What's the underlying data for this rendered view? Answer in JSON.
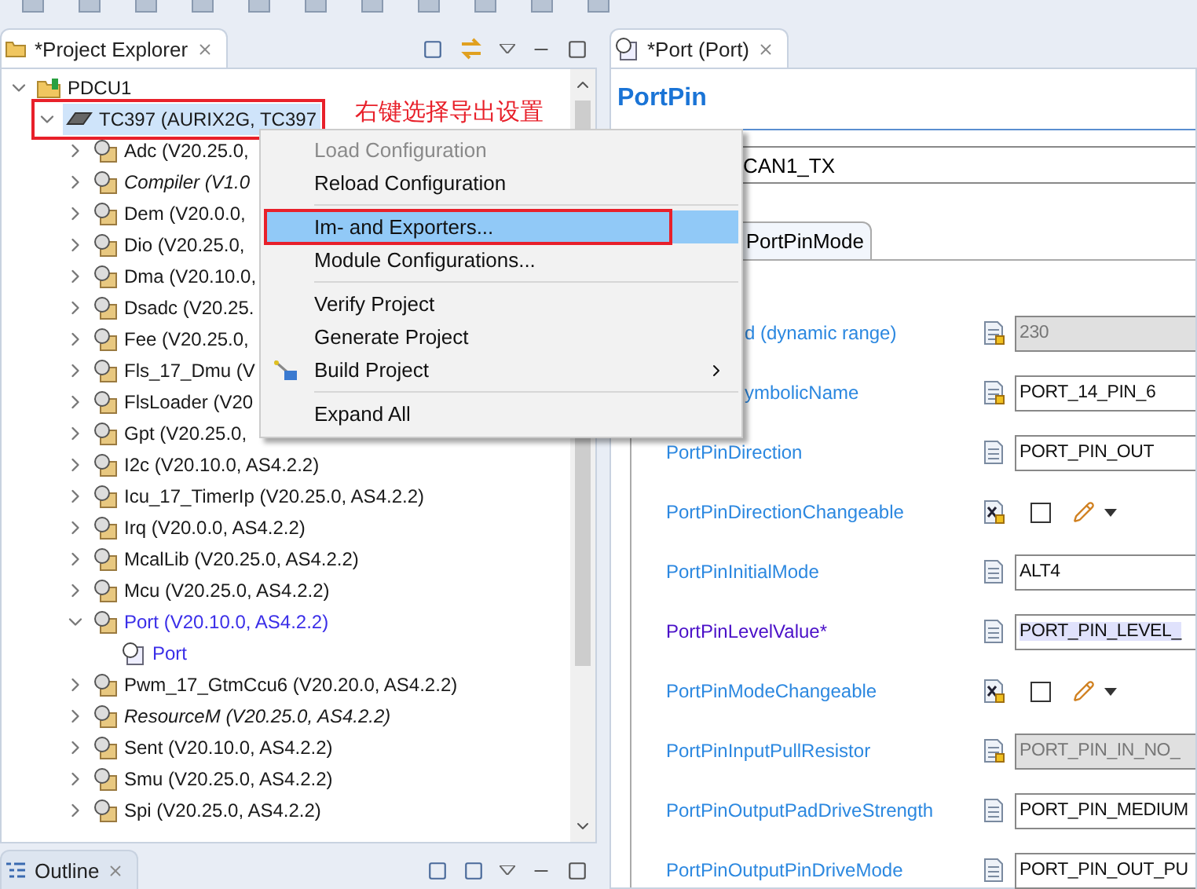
{
  "explorer": {
    "tab": {
      "title": "*Project Explorer"
    },
    "tree": [
      {
        "kind": "project",
        "label": "PDCU1",
        "expanded": true,
        "selected": false,
        "marked": false,
        "italic": false,
        "active": false,
        "children": [
          {
            "kind": "chip",
            "label": "TC397 (AURIX2G, TC397",
            "expanded": true,
            "selected": true,
            "marked": true,
            "italic": false,
            "active": false,
            "children": [
              {
                "kind": "module",
                "label": "Adc (V20.25.0,",
                "expanded": false,
                "selected": false,
                "marked": false,
                "italic": false,
                "active": false
              },
              {
                "kind": "module",
                "label": "Compiler (V1.0",
                "expanded": false,
                "selected": false,
                "marked": false,
                "italic": true,
                "active": false
              },
              {
                "kind": "module",
                "label": "Dem (V20.0.0,",
                "expanded": false,
                "selected": false,
                "marked": false,
                "italic": false,
                "active": false
              },
              {
                "kind": "module",
                "label": "Dio (V20.25.0,",
                "expanded": false,
                "selected": false,
                "marked": false,
                "italic": false,
                "active": false
              },
              {
                "kind": "module",
                "label": "Dma (V20.10.0,",
                "expanded": false,
                "selected": false,
                "marked": false,
                "italic": false,
                "active": false
              },
              {
                "kind": "module",
                "label": "Dsadc (V20.25.",
                "expanded": false,
                "selected": false,
                "marked": false,
                "italic": false,
                "active": false
              },
              {
                "kind": "module",
                "label": "Fee (V20.25.0,",
                "expanded": false,
                "selected": false,
                "marked": false,
                "italic": false,
                "active": false
              },
              {
                "kind": "module",
                "label": "Fls_17_Dmu (V",
                "expanded": false,
                "selected": false,
                "marked": false,
                "italic": false,
                "active": false
              },
              {
                "kind": "module",
                "label": "FlsLoader (V20",
                "expanded": false,
                "selected": false,
                "marked": false,
                "italic": false,
                "active": false
              },
              {
                "kind": "module",
                "label": "Gpt (V20.25.0,",
                "expanded": false,
                "selected": false,
                "marked": false,
                "italic": false,
                "active": false
              },
              {
                "kind": "module",
                "label": "I2c (V20.10.0, AS4.2.2)",
                "expanded": false,
                "selected": false,
                "marked": false,
                "italic": false,
                "active": false
              },
              {
                "kind": "module",
                "label": "Icu_17_TimerIp (V20.25.0, AS4.2.2)",
                "expanded": false,
                "selected": false,
                "marked": false,
                "italic": false,
                "active": false
              },
              {
                "kind": "module",
                "label": "Irq (V20.0.0, AS4.2.2)",
                "expanded": false,
                "selected": false,
                "marked": false,
                "italic": false,
                "active": false
              },
              {
                "kind": "module",
                "label": "McalLib (V20.25.0, AS4.2.2)",
                "expanded": false,
                "selected": false,
                "marked": false,
                "italic": false,
                "active": false
              },
              {
                "kind": "module",
                "label": "Mcu (V20.25.0, AS4.2.2)",
                "expanded": false,
                "selected": false,
                "marked": false,
                "italic": false,
                "active": false
              },
              {
                "kind": "module",
                "label": "Port (V20.10.0, AS4.2.2)",
                "expanded": true,
                "selected": false,
                "marked": false,
                "italic": false,
                "active": true,
                "children": [
                  {
                    "kind": "config",
                    "label": "Port",
                    "selected": false,
                    "marked": false,
                    "italic": false,
                    "active": true
                  }
                ]
              },
              {
                "kind": "module",
                "label": "Pwm_17_GtmCcu6 (V20.20.0, AS4.2.2)",
                "expanded": false,
                "selected": false,
                "marked": false,
                "italic": false,
                "active": false
              },
              {
                "kind": "module",
                "label": "ResourceM (V20.25.0, AS4.2.2)",
                "expanded": false,
                "selected": false,
                "marked": false,
                "italic": true,
                "active": false
              },
              {
                "kind": "module",
                "label": "Sent (V20.10.0, AS4.2.2)",
                "expanded": false,
                "selected": false,
                "marked": false,
                "italic": false,
                "active": false
              },
              {
                "kind": "module",
                "label": "Smu (V20.25.0, AS4.2.2)",
                "expanded": false,
                "selected": false,
                "marked": false,
                "italic": false,
                "active": false
              },
              {
                "kind": "module",
                "label": "Spi (V20.25.0, AS4.2.2)",
                "expanded": false,
                "selected": false,
                "marked": false,
                "italic": false,
                "active": false
              }
            ]
          }
        ]
      }
    ]
  },
  "annotation": {
    "text": "右键选择导出设置"
  },
  "context_menu": [
    {
      "kind": "item",
      "label": "Load Configuration",
      "disabled": true,
      "selected": false,
      "marked": false,
      "submenu": false,
      "icon": false
    },
    {
      "kind": "item",
      "label": "Reload Configuration",
      "disabled": false,
      "selected": false,
      "marked": false,
      "submenu": false,
      "icon": false
    },
    {
      "kind": "separator"
    },
    {
      "kind": "item",
      "label": "Im- and Exporters...",
      "disabled": false,
      "selected": true,
      "marked": true,
      "submenu": false,
      "icon": false
    },
    {
      "kind": "item",
      "label": "Module Configurations...",
      "disabled": false,
      "selected": false,
      "marked": false,
      "submenu": false,
      "icon": false
    },
    {
      "kind": "separator"
    },
    {
      "kind": "item",
      "label": "Verify Project",
      "disabled": false,
      "selected": false,
      "marked": false,
      "submenu": false,
      "icon": false
    },
    {
      "kind": "item",
      "label": "Generate Project",
      "disabled": false,
      "selected": false,
      "marked": false,
      "submenu": false,
      "icon": false
    },
    {
      "kind": "item",
      "label": "Build Project",
      "disabled": false,
      "selected": false,
      "marked": false,
      "submenu": true,
      "icon": true
    },
    {
      "kind": "separator"
    },
    {
      "kind": "item",
      "label": "Expand All",
      "disabled": false,
      "selected": false,
      "marked": false,
      "submenu": false,
      "icon": false
    }
  ],
  "outline": {
    "tab": {
      "title": "Outline"
    }
  },
  "editor": {
    "tab": {
      "title": "*Port (Port)"
    },
    "heading": "PortPin",
    "name_value": "CAN1_TX",
    "subtab": "PortPinMode",
    "rows": [
      {
        "kind": "number",
        "label": "d (dynamic range)",
        "covered": true,
        "value": "230",
        "disabled": true,
        "badge": true,
        "modified": false
      },
      {
        "kind": "text",
        "label": "ymbolicName",
        "covered": true,
        "value": "PORT_14_PIN_6",
        "disabled": false,
        "badge": true,
        "modified": false
      },
      {
        "kind": "text",
        "label": "PortPinDirection",
        "value": "PORT_PIN_OUT",
        "disabled": false,
        "badge": false,
        "modified": false
      },
      {
        "kind": "boolean",
        "label": "PortPinDirectionChangeable",
        "checked": false,
        "badge": true,
        "modified": false
      },
      {
        "kind": "text",
        "label": "PortPinInitialMode",
        "value": "ALT4",
        "disabled": false,
        "badge": false,
        "modified": false
      },
      {
        "kind": "text",
        "label": "PortPinLevelValue*",
        "value": "PORT_PIN_LEVEL_",
        "disabled": false,
        "badge": false,
        "modified": true
      },
      {
        "kind": "boolean",
        "label": "PortPinModeChangeable",
        "checked": false,
        "badge": true,
        "modified": false
      },
      {
        "kind": "text",
        "label": "PortPinInputPullResistor",
        "value": "PORT_PIN_IN_NO_",
        "disabled": true,
        "badge": true,
        "modified": false
      },
      {
        "kind": "text",
        "label": "PortPinOutputPadDriveStrength",
        "value": "PORT_PIN_MEDIUM",
        "disabled": false,
        "badge": false,
        "modified": false
      },
      {
        "kind": "text",
        "label": "PortPinOutputPinDriveMode",
        "value": "PORT_PIN_OUT_PU",
        "disabled": false,
        "badge": false,
        "modified": false
      }
    ]
  }
}
